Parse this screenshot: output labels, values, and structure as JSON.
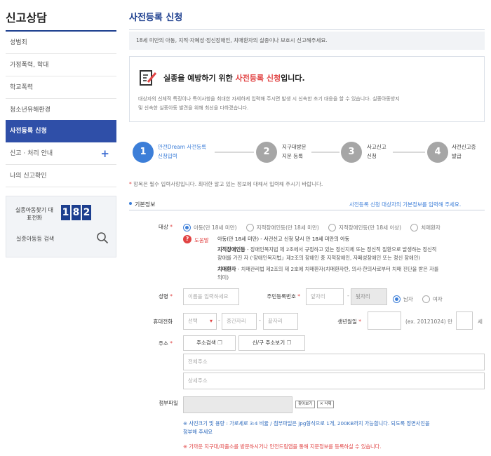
{
  "sidebar": {
    "title": "신고상담",
    "items": [
      {
        "label": "성범죄"
      },
      {
        "label": "가정폭력, 학대"
      },
      {
        "label": "학교폭력"
      },
      {
        "label": "청소년유해환경"
      },
      {
        "label": "사전등록 신청"
      },
      {
        "label": "신고 · 처리 안내"
      },
      {
        "label": "나의 신고확인"
      }
    ],
    "hotline": {
      "label": "실종아동찾기 대표전화",
      "digits": [
        "1",
        "8",
        "2"
      ],
      "search_label": "실종아동등 검색"
    }
  },
  "main": {
    "title": "사전등록 신청",
    "notice": "18세 미만의 아동, 지적·자폐성·정신장애인, 치매환자의 실종이나 보호시 신고해주세요.",
    "intro_title_a": "실종을 예방하기 위한 ",
    "intro_title_b": "사전등록 신청",
    "intro_title_c": "입니다.",
    "intro_body_1": "대상자의 신체적 특징이나 특이사항을 최대한 자세하게 입력해 주시면 발생 시 신속한 초기 대응을 할 수 있습니다. 실종아동방지",
    "intro_body_2": "및 신속한 실종아동 발견을 위해 최선을 다하겠습니다.",
    "steps": [
      {
        "num": "1",
        "line1": "안전Dream 사전등록",
        "line2": "신청입력"
      },
      {
        "num": "2",
        "line1": "지구대방문",
        "line2": "지문 등록"
      },
      {
        "num": "3",
        "line1": "사고신고",
        "line2": "신청"
      },
      {
        "num": "4",
        "line1": "사전신고증",
        "line2": "발급"
      }
    ],
    "required_mark": "*",
    "required_text": "항목은 필수 입력사항입니다. 최대한 알고 있는 정보에 대해서 입력해 주시기 바랍니다.",
    "basic_title": "기본정보",
    "basic_note": "사전등록 신청 대상자의 기본정보를 입력해 주세요.",
    "form": {
      "target_label": "대상",
      "target_options": [
        "아동(만 18세 미만)",
        "지적장애인등(만 18세 미만)",
        "지적장애인등(만 18세 이상)",
        "치매환자"
      ],
      "help_icon": "?",
      "help_title": "도움말",
      "help_child": "아동(만 18세 미만) - 사건신고 신청 당시 만 18세 미만의 아동",
      "help_disabled_h": "지적장애인등",
      "help_disabled_1": " - 장애인복지법 제 2조에서 규정하고 있는 정신지체 또는 정신적 질환으로 발생하는 정신적",
      "help_disabled_2": "장애를 가진 자 ('장애인복지법」제2조의 장애인 중 지적장애인, 자폐성장애인 또는 정신 장애인)",
      "help_dementia_h": "치매환자",
      "help_dementia_1": " - 치매관리법 제2조의 제 2호에 치매환자(치매환자란, 의사·한의사로부터 치매 진단을 받은 자를",
      "help_dementia_2": "의미)",
      "name_label": "성명",
      "name_placeholder": "이름을 입력하세요",
      "rrn_label": "주민등록번호",
      "rrn_front": "앞자리",
      "rrn_back": "뒷자리",
      "gender_options": [
        "남자",
        "여자"
      ],
      "phone_label": "휴대전화",
      "phone_prefix": "선택",
      "phone_mid": "중간자리",
      "phone_last": "끝자리",
      "birth_label": "생년월일",
      "birth_hint": "(ex. 20121024) 만",
      "birth_unit": "세",
      "addr_label": "주소",
      "addr_search": "주소검색",
      "addr_new": "신/구 주소보기",
      "addr_full": "전체주소",
      "addr_detail": "상세주소",
      "file_label": "첨부파일",
      "file_browse": "찾아보기",
      "file_delete": "✕ 삭제",
      "file_note_1": "※ 사진크기 및 용량 : 가로세로 3:4 비율 / 첨부파일은 jpg형식으로 1개, 200KB까지 가능합니다. 되도록 정면사진을",
      "file_note_2": "첨부해 주세요",
      "file_warn": "※ 가까운 지구대/파출소를 방문하시거나 안전드림앱을 통해 지문정보를 등록하실 수 있습니다."
    }
  }
}
